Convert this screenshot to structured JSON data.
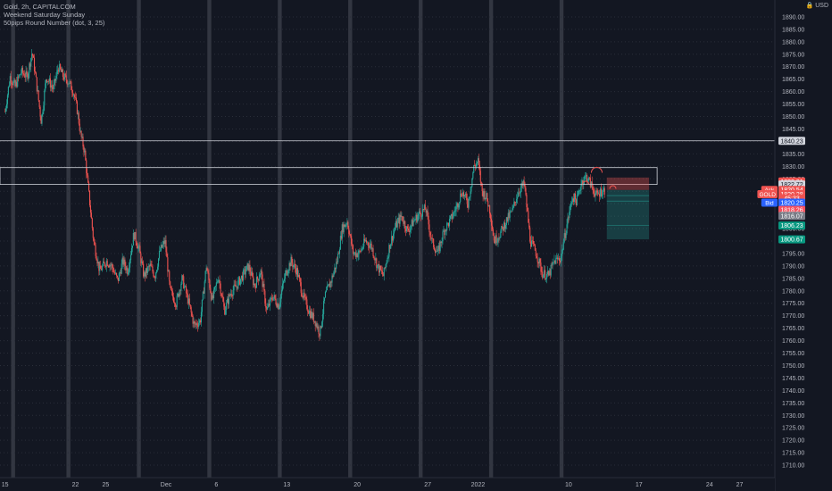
{
  "header": {
    "symbol_line": "Gold, 2h, CAPITALCOM",
    "indicator_1": "Weekend Saturday Sunday",
    "indicator_2": "50pips Round Number (dot, 3, 25)",
    "currency": "USD",
    "currency_icon": "lock-icon"
  },
  "colors": {
    "background": "#131722",
    "up": "#26a69a",
    "down": "#ef5350",
    "weekend_band": "#363a45",
    "grid_dot": "#2a2e39",
    "axis_text": "#b2b5be",
    "level_line": "#d1d4dc",
    "bid": "#2962ff",
    "gold_label": "#ef5350",
    "ask": "#ef5350"
  },
  "chart_data": {
    "type": "candlestick",
    "title": "Gold, 2h, CAPITALCOM",
    "ylim": [
      1705,
      1895
    ],
    "y_ticks": [
      1710,
      1715,
      1720,
      1725,
      1730,
      1735,
      1740,
      1745,
      1750,
      1755,
      1760,
      1765,
      1770,
      1775,
      1780,
      1785,
      1790,
      1795,
      1800,
      1805,
      1810,
      1815,
      1820,
      1825,
      1830,
      1835,
      1840,
      1845,
      1850,
      1855,
      1860,
      1865,
      1870,
      1875,
      1880,
      1885,
      1890
    ],
    "x_ticks": [
      "15",
      "22",
      "25",
      "Dec",
      "6",
      "13",
      "20",
      "27",
      "2022",
      "10",
      "17",
      "24",
      "27"
    ],
    "x_tick_days": [
      0,
      7,
      10,
      16,
      21,
      28,
      35,
      42,
      47,
      56,
      63,
      70,
      73
    ],
    "x_range_days": [
      -0.5,
      76.5
    ],
    "weekend_days": [
      0.8,
      6.3,
      13.3,
      20.3,
      27.3,
      34.3,
      41.3,
      48.3,
      55.3
    ],
    "price_path": [
      [
        0,
        1852
      ],
      [
        0.5,
        1866
      ],
      [
        1,
        1862
      ],
      [
        1.6,
        1868
      ],
      [
        2.2,
        1866
      ],
      [
        2.7,
        1876
      ],
      [
        3.1,
        1864
      ],
      [
        3.6,
        1848
      ],
      [
        4.1,
        1866
      ],
      [
        4.8,
        1861
      ],
      [
        5.3,
        1870
      ],
      [
        5.8,
        1866
      ],
      [
        6.3,
        1864
      ],
      [
        6.8,
        1860
      ],
      [
        7.2,
        1852
      ],
      [
        7.5,
        1843
      ],
      [
        7.9,
        1836
      ],
      [
        8.3,
        1820
      ],
      [
        8.8,
        1800
      ],
      [
        9.4,
        1788
      ],
      [
        10.1,
        1792
      ],
      [
        10.6,
        1790
      ],
      [
        11.2,
        1784
      ],
      [
        11.7,
        1792
      ],
      [
        12.2,
        1788
      ],
      [
        12.8,
        1803
      ],
      [
        13.3,
        1797
      ],
      [
        13.8,
        1786
      ],
      [
        14.4,
        1790
      ],
      [
        14.9,
        1786
      ],
      [
        15.4,
        1796
      ],
      [
        15.9,
        1800
      ],
      [
        16.4,
        1780
      ],
      [
        17.0,
        1775
      ],
      [
        17.6,
        1785
      ],
      [
        18.2,
        1776
      ],
      [
        18.8,
        1766
      ],
      [
        19.4,
        1768
      ],
      [
        20.0,
        1790
      ],
      [
        20.6,
        1776
      ],
      [
        21.2,
        1786
      ],
      [
        21.8,
        1772
      ],
      [
        22.4,
        1779
      ],
      [
        23.0,
        1782
      ],
      [
        23.6,
        1786
      ],
      [
        24.2,
        1790
      ],
      [
        24.8,
        1782
      ],
      [
        25.4,
        1788
      ],
      [
        26.0,
        1772
      ],
      [
        26.6,
        1778
      ],
      [
        27.2,
        1774
      ],
      [
        27.8,
        1786
      ],
      [
        28.4,
        1792
      ],
      [
        29.0,
        1788
      ],
      [
        29.6,
        1778
      ],
      [
        30.2,
        1772
      ],
      [
        30.8,
        1768
      ],
      [
        31.3,
        1763
      ],
      [
        31.8,
        1778
      ],
      [
        32.4,
        1784
      ],
      [
        33.0,
        1792
      ],
      [
        33.5,
        1805
      ],
      [
        34.0,
        1808
      ],
      [
        34.6,
        1795
      ],
      [
        35.2,
        1795
      ],
      [
        35.8,
        1800
      ],
      [
        36.4,
        1798
      ],
      [
        37.0,
        1790
      ],
      [
        37.6,
        1786
      ],
      [
        38.2,
        1798
      ],
      [
        38.8,
        1806
      ],
      [
        39.4,
        1810
      ],
      [
        40.0,
        1804
      ],
      [
        40.6,
        1808
      ],
      [
        41.2,
        1811
      ],
      [
        41.8,
        1813
      ],
      [
        42.4,
        1800
      ],
      [
        43.0,
        1795
      ],
      [
        43.6,
        1804
      ],
      [
        44.2,
        1808
      ],
      [
        44.8,
        1813
      ],
      [
        45.4,
        1820
      ],
      [
        46.0,
        1815
      ],
      [
        46.6,
        1830
      ],
      [
        47.0,
        1832
      ],
      [
        47.4,
        1820
      ],
      [
        47.8,
        1818
      ],
      [
        48.2,
        1812
      ],
      [
        48.6,
        1800
      ],
      [
        49.2,
        1803
      ],
      [
        49.8,
        1808
      ],
      [
        50.4,
        1812
      ],
      [
        51.0,
        1820
      ],
      [
        51.6,
        1823
      ],
      [
        52.2,
        1800
      ],
      [
        52.8,
        1795
      ],
      [
        53.4,
        1787
      ],
      [
        54.0,
        1786
      ],
      [
        54.6,
        1792
      ],
      [
        55.2,
        1793
      ],
      [
        55.8,
        1806
      ],
      [
        56.4,
        1818
      ],
      [
        56.8,
        1816
      ],
      [
        57.3,
        1824
      ],
      [
        57.8,
        1826
      ],
      [
        58.3,
        1822
      ],
      [
        58.8,
        1818
      ],
      [
        59.2,
        1820
      ],
      [
        59.6,
        1820.3
      ]
    ],
    "levels": [
      {
        "name": "resistance-line",
        "price": 1840.23,
        "label": "1840.23"
      }
    ],
    "zone": {
      "top": 1829.5,
      "bottom": 1822.72,
      "day_start": -0.5,
      "day_end": 64.8
    },
    "position": {
      "entry": 1820.5,
      "target": 1800.67,
      "stop": 1825.5,
      "day_start": 59.8,
      "day_end": 64.0,
      "secondary": [
        1818.26,
        1816.07,
        1806.23
      ]
    },
    "markers": [
      {
        "type": "arc",
        "day": 58.8,
        "price": 1828.5,
        "color": "#ef5350",
        "size": "large"
      },
      {
        "type": "arc",
        "day": 57.7,
        "price": 1823.4,
        "color": "#ef5350",
        "size": "small"
      },
      {
        "type": "arc",
        "day": 60.4,
        "price": 1821.6,
        "color": "#ef5350",
        "size": "small"
      }
    ],
    "price_labels": [
      {
        "text": "1840.23",
        "price": 1840.23,
        "bg": "#d1d4dc",
        "fg": "#131722"
      },
      {
        "text": "1823.91",
        "price": 1823.91,
        "bg": "#ef5350",
        "fg": "#ffffff"
      },
      {
        "text": "1822.72",
        "price": 1822.72,
        "bg": "#d1d4dc",
        "fg": "#131722"
      },
      {
        "text": "1820.54",
        "price": 1820.54,
        "bg": "#ef5350",
        "fg": "#ffffff",
        "tag": "Ask",
        "tag_bg": "#ef5350"
      },
      {
        "text": "1820.28",
        "price": 1818.8,
        "bg": "#ef5350",
        "fg": "#ffffff",
        "tag": "GOLD",
        "tag_bg": "#ef5350"
      },
      {
        "text": "45:33",
        "price": 1817.2,
        "bg": "#ef5350",
        "fg": "#ffffff"
      },
      {
        "text": "1820.25",
        "price": 1815.4,
        "bg": "#2962ff",
        "fg": "#ffffff",
        "tag": "Bid",
        "tag_bg": "#2962ff"
      },
      {
        "text": "1818.26",
        "price": 1812.5,
        "bg": "#f7525f",
        "fg": "#ffffff"
      },
      {
        "text": "1816.07",
        "price": 1810.1,
        "bg": "#787b86",
        "fg": "#ffffff"
      },
      {
        "text": "1806.23",
        "price": 1806.23,
        "bg": "#089981",
        "fg": "#ffffff"
      },
      {
        "text": "1800.67",
        "price": 1800.67,
        "bg": "#089981",
        "fg": "#ffffff"
      }
    ]
  }
}
